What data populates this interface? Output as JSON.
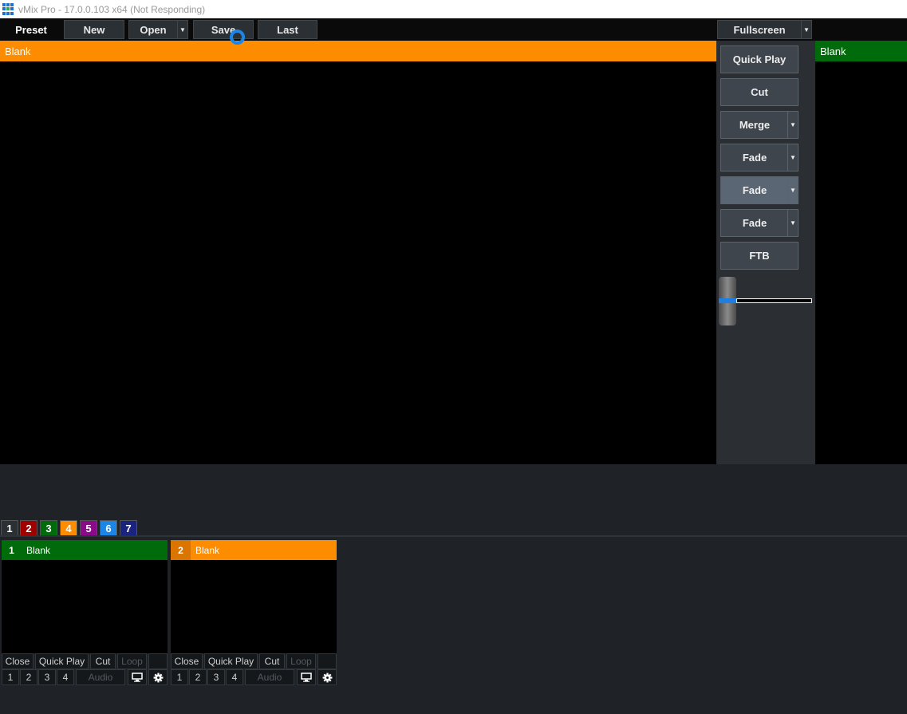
{
  "window": {
    "title": "vMix Pro - 17.0.0.103 x64 (Not Responding)",
    "logo_colors": [
      "#1f6fd1",
      "#1f6fd1",
      "#1f6fd1",
      "#1f6fd1",
      "#2fa84f",
      "#1f6fd1",
      "#1f6fd1",
      "#1f6fd1",
      "#1f6fd1"
    ]
  },
  "toolbar": {
    "preset_label": "Preset",
    "new_label": "New",
    "open_label": "Open",
    "save_label": "Save",
    "last_label": "Last",
    "fullscreen_label": "Fullscreen"
  },
  "preview": {
    "title": "Blank",
    "color": "#fd8c00"
  },
  "program": {
    "title": "Blank",
    "color": "#006b0a"
  },
  "transitions": {
    "quick_play": "Quick Play",
    "cut": "Cut",
    "merge": "Merge",
    "fade1": "Fade",
    "fade2": "Fade",
    "fade3": "Fade",
    "ftb": "FTB",
    "tbar_position": 0
  },
  "tabs": [
    {
      "label": "1",
      "color": "#2b3034"
    },
    {
      "label": "2",
      "color": "#a00000"
    },
    {
      "label": "3",
      "color": "#006b0a"
    },
    {
      "label": "4",
      "color": "#fd8c00"
    },
    {
      "label": "5",
      "color": "#8a0a8a"
    },
    {
      "label": "6",
      "color": "#1c86e8"
    },
    {
      "label": "7",
      "color": "#1a237e"
    }
  ],
  "inputs": [
    {
      "number": "1",
      "name": "Blank",
      "header_color": "#006b0a",
      "number_color": "#006b0a",
      "close": "Close",
      "quick_play": "Quick Play",
      "cut": "Cut",
      "loop": "Loop",
      "outputs": [
        "1",
        "2",
        "3",
        "4"
      ],
      "audio": "Audio"
    },
    {
      "number": "2",
      "name": "Blank",
      "header_color": "#fd8c00",
      "number_color": "#d97500",
      "close": "Close",
      "quick_play": "Quick Play",
      "cut": "Cut",
      "loop": "Loop",
      "outputs": [
        "1",
        "2",
        "3",
        "4"
      ],
      "audio": "Audio"
    }
  ]
}
